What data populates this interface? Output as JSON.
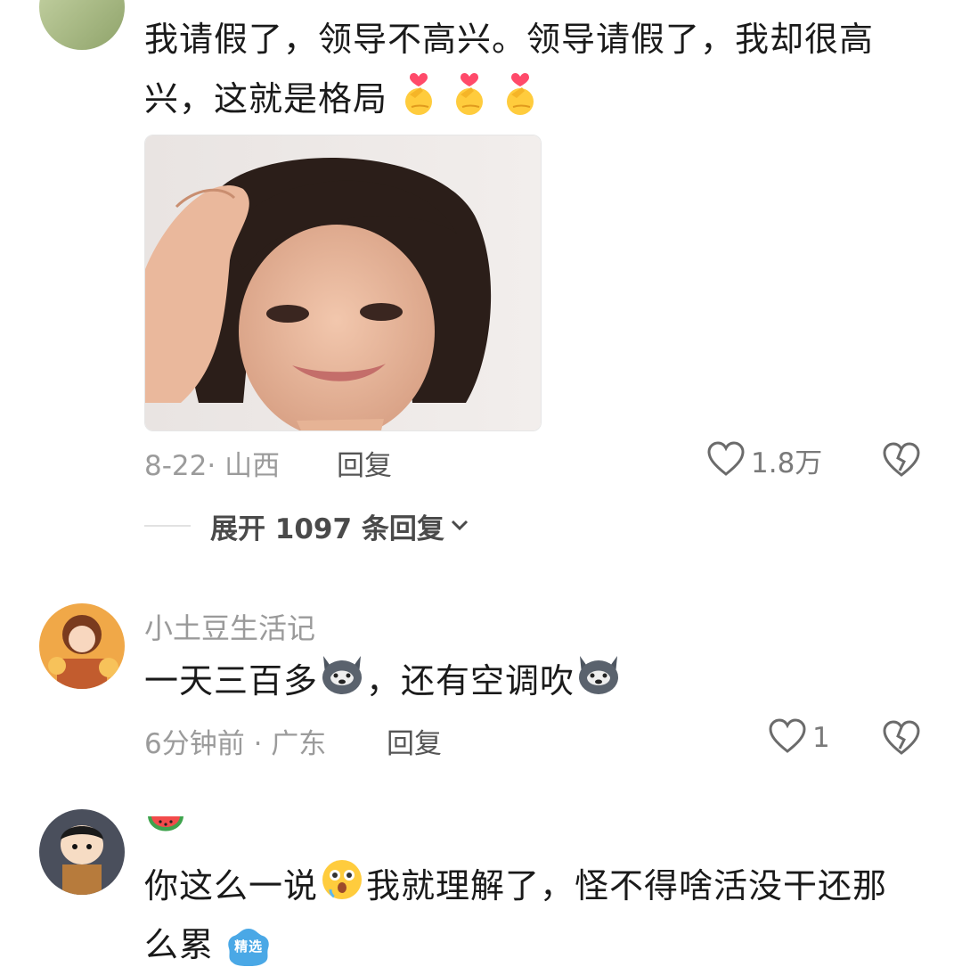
{
  "comments": [
    {
      "text_line1": "我请假了，领导不高兴。领导请假了，我却很高",
      "text_line2": "兴，这就是格局",
      "date": "8-22· 山西",
      "reply_label": "回复",
      "like_count": "1.8万",
      "expand_label": "展开 1097 条回复",
      "inline_emoji": "finger-heart-emoji"
    },
    {
      "username": "小土豆生活记",
      "text_part1": "一天三百多",
      "text_part2": "，还有空调吹",
      "date": "6分钟前 · 广东",
      "reply_label": "回复",
      "like_count": "1",
      "inline_emoji": "husky-dog-emoji"
    },
    {
      "username_emoji": "watermelon-emoji",
      "text_part1": "你这么一说",
      "text_part2": "我就理解了，怪不得啥活没干还那",
      "text_line2": "么累",
      "badge": "精选",
      "inline_emoji": "shocked-face-emoji"
    }
  ],
  "colors": {
    "text": "#1a1a1a",
    "meta": "#9b9b9b",
    "icon": "#6b6b6b",
    "badge": "#4aa8e6"
  }
}
